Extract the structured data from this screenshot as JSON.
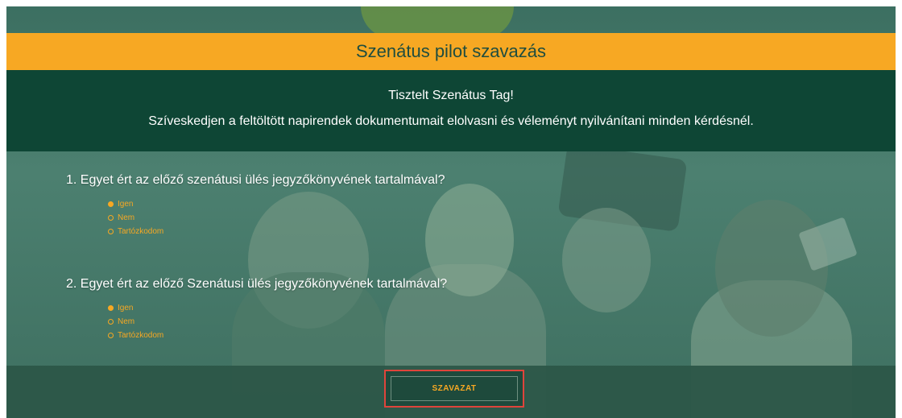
{
  "header": {
    "title": "Szenátus pilot szavazás"
  },
  "intro": {
    "heading": "Tisztelt Szenátus Tag!",
    "text": "Szíveskedjen a feltöltött napirendek dokumentumait elolvasni és véleményt nyilvánítani minden kérdésnél."
  },
  "questions": [
    {
      "text": "1. Egyet ért az előző szenátusi ülés jegyzőkönyvének tartalmával?",
      "options": [
        {
          "label": "Igen",
          "checked": true
        },
        {
          "label": "Nem",
          "checked": false
        },
        {
          "label": "Tartózkodom",
          "checked": false
        }
      ]
    },
    {
      "text": "2. Egyet ért az előző Szenátusi ülés jegyzőkönyvének tartalmával?",
      "options": [
        {
          "label": "Igen",
          "checked": true
        },
        {
          "label": "Nem",
          "checked": false
        },
        {
          "label": "Tartózkodom",
          "checked": false
        }
      ]
    }
  ],
  "footer": {
    "submit_label": "SZAVAZAT"
  },
  "colors": {
    "accent": "#f7a823",
    "dark_green": "#0e4635",
    "highlight_border": "#e0443b"
  }
}
